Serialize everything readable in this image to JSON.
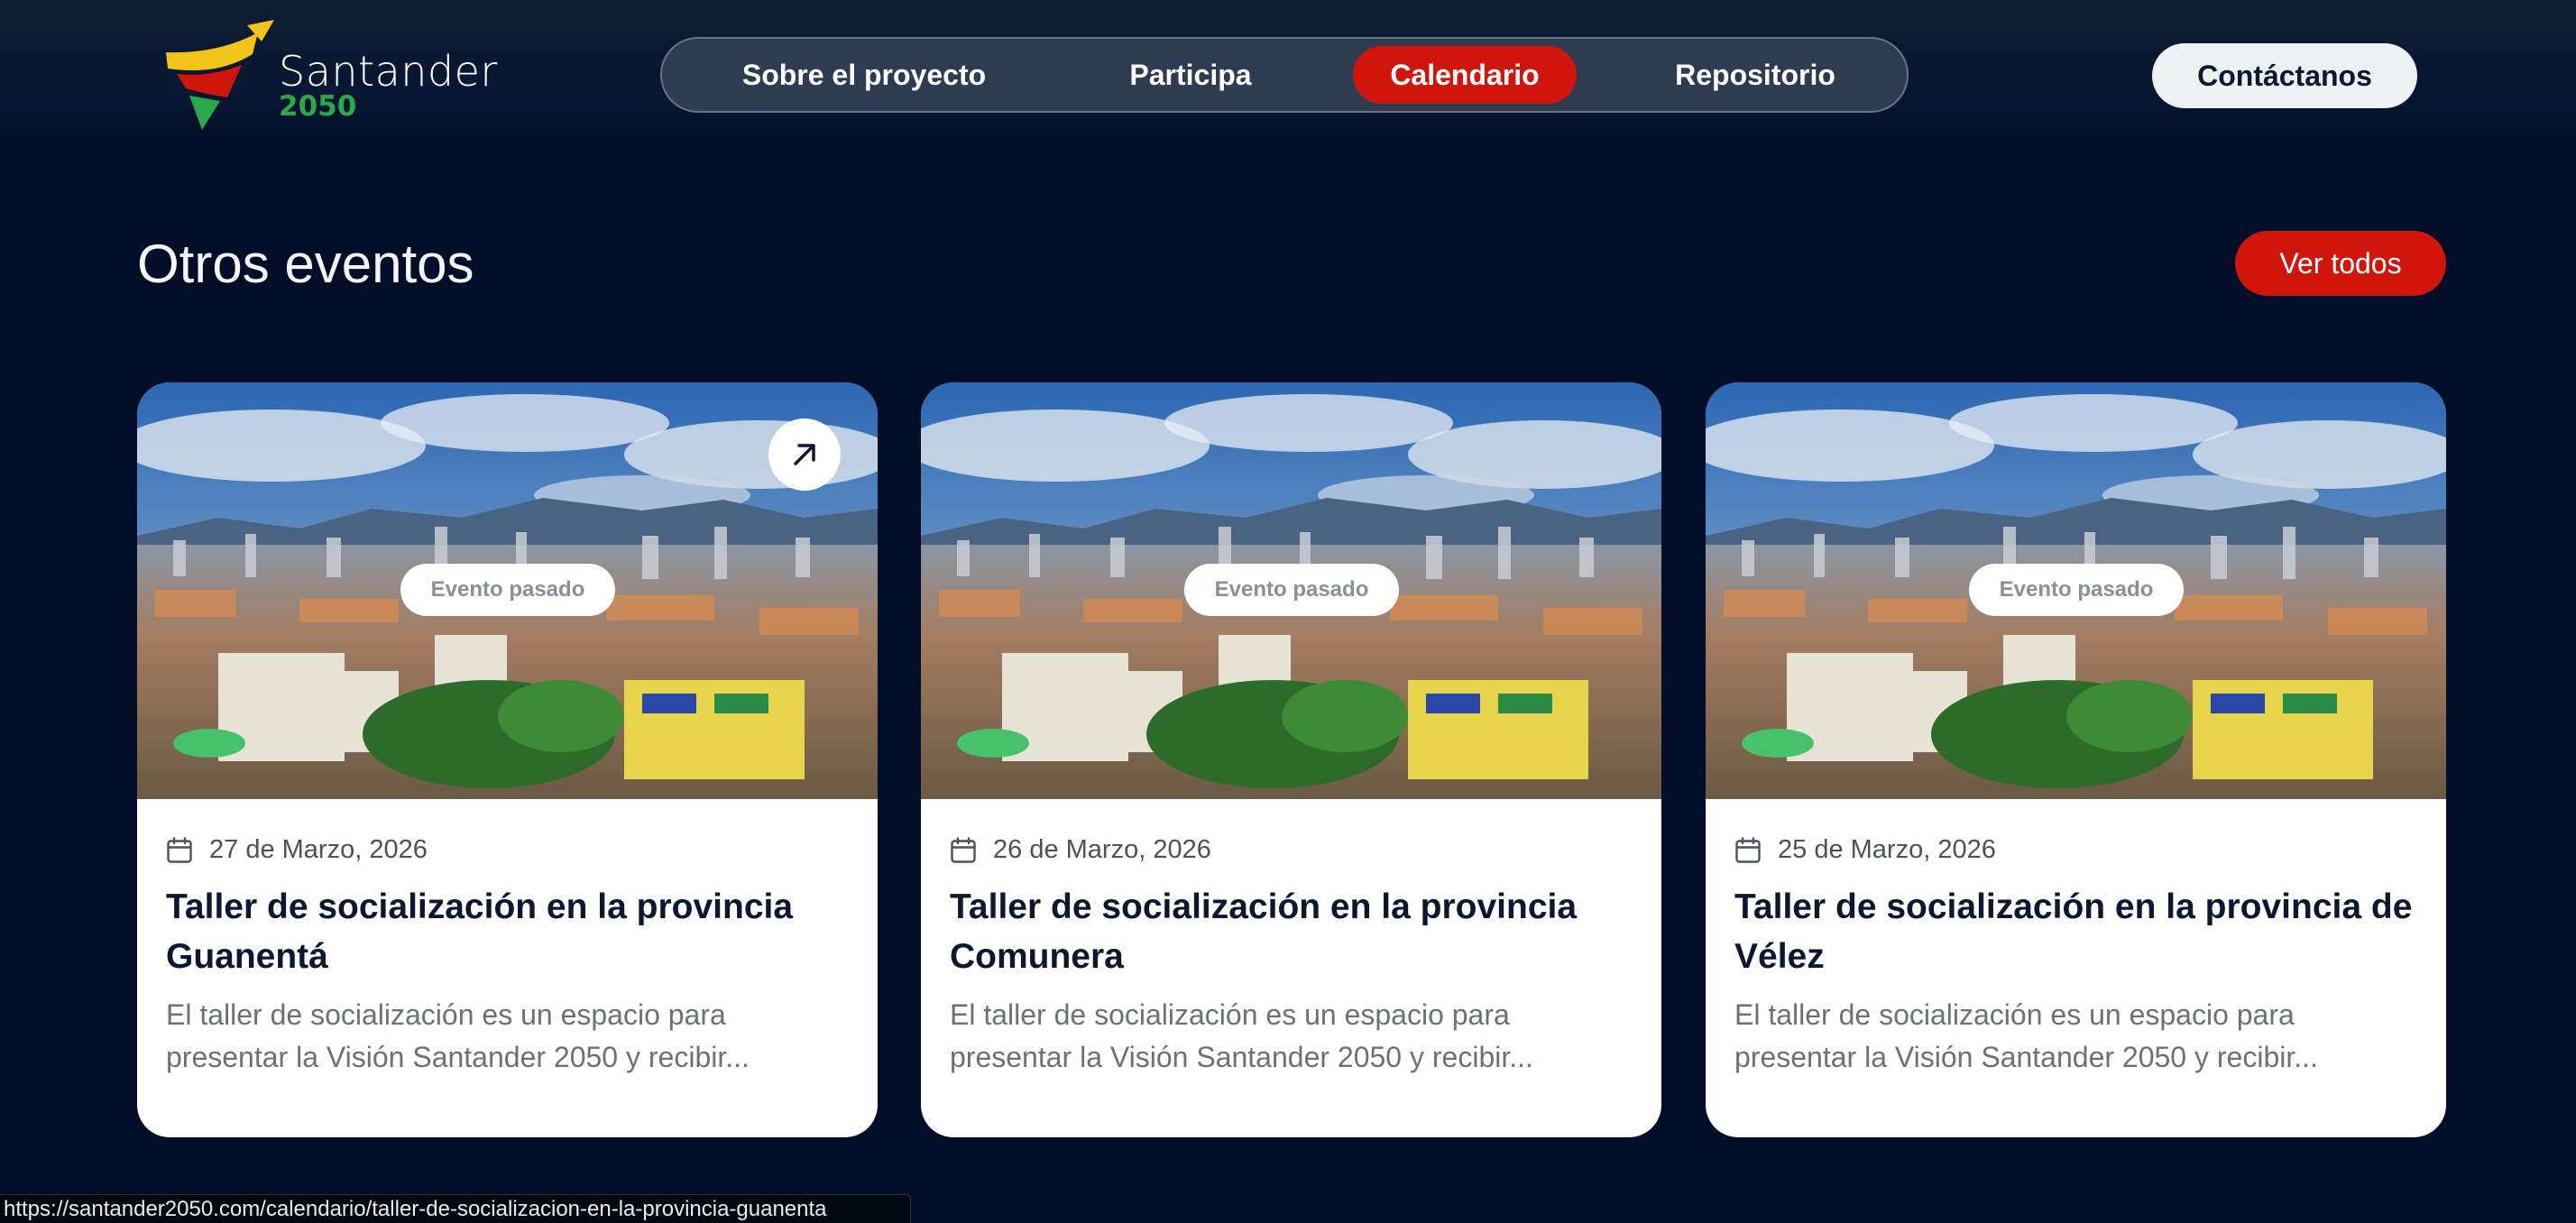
{
  "brand": {
    "name": "Santander",
    "year": "2050",
    "colors": {
      "yellow": "#f2c318",
      "red": "#d0150c",
      "green": "#2aa84a"
    }
  },
  "nav": {
    "items": [
      {
        "label": "Sobre el proyecto",
        "active": false
      },
      {
        "label": "Participa",
        "active": false
      },
      {
        "label": "Calendario",
        "active": true
      },
      {
        "label": "Repositorio",
        "active": false
      }
    ],
    "contact_label": "Contáctanos"
  },
  "section": {
    "title": "Otros eventos",
    "see_all_label": "Ver todos"
  },
  "events": [
    {
      "badge": "Evento pasado",
      "date": "27 de Marzo, 2026",
      "title": "Taller de socialización en la provincia Guanentá",
      "description": "El taller de socialización es un espacio para presentar la Visión Santander 2050 y recibir..."
    },
    {
      "badge": "Evento pasado",
      "date": "26 de Marzo, 2026",
      "title": "Taller de socialización en la provincia Comunera",
      "description": "El taller de socialización es un espacio para presentar la Visión Santander 2050 y recibir..."
    },
    {
      "badge": "Evento pasado",
      "date": "25 de Marzo, 2026",
      "title": "Taller de socialización en la provincia de Vélez",
      "description": "El taller de socialización es un espacio para presentar la Visión Santander 2050 y recibir..."
    }
  ],
  "status_bar": {
    "url": "https://santander2050.com/calendario/taller-de-socializacion-en-la-provincia-guanenta"
  }
}
